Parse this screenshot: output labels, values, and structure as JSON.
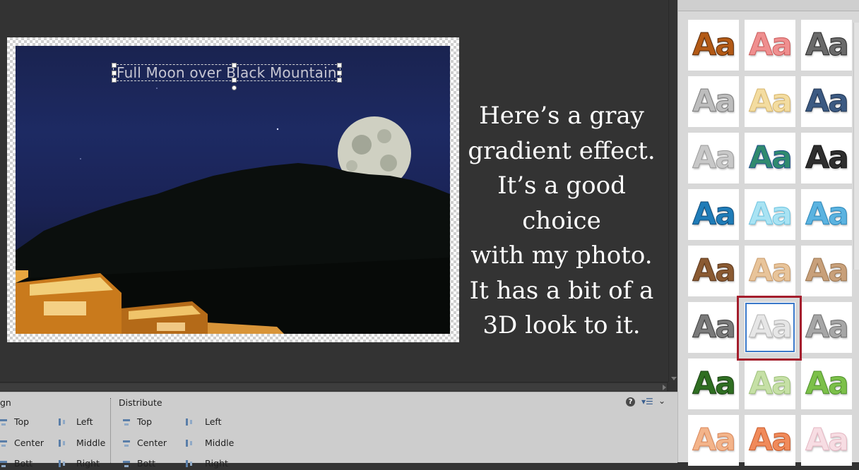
{
  "document": {
    "text_layer": "Full Moon over Black Mountain"
  },
  "caption": {
    "lines": [
      "Here’s a gray",
      "gradient effect.",
      "It’s a good choice",
      "with my photo.",
      "It has a bit of a",
      "3D look to it."
    ]
  },
  "align_panel": {
    "title": "gn",
    "items": [
      {
        "label": "Top"
      },
      {
        "label": "Left"
      },
      {
        "label": "Center"
      },
      {
        "label": "Middle"
      },
      {
        "label": "Bott"
      },
      {
        "label": "Right"
      }
    ]
  },
  "distribute_panel": {
    "title": "Distribute",
    "items": [
      {
        "label": "Top"
      },
      {
        "label": "Left"
      },
      {
        "label": "Center"
      },
      {
        "label": "Middle"
      },
      {
        "label": "Bott"
      },
      {
        "label": "Right"
      }
    ]
  },
  "panel_icons": {
    "help": "?",
    "menu": "▾☰",
    "collapse": "⌄"
  },
  "styles": {
    "sample_text": "Aa",
    "selected_index": 16,
    "swatches": [
      {
        "name": "leopard",
        "fill": "#b35a16",
        "stroke": "#5a2a08"
      },
      {
        "name": "pink",
        "fill": "#ef8f8f",
        "stroke": "#c95a5a"
      },
      {
        "name": "dark-chrome",
        "fill": "#6a6a6a",
        "stroke": "#2a2a2a"
      },
      {
        "name": "silver-bevel",
        "fill": "#bdbdbd",
        "stroke": "#7a7a7a"
      },
      {
        "name": "cream",
        "fill": "#f3dca0",
        "stroke": "#d6b46a"
      },
      {
        "name": "denim",
        "fill": "#3c5a82",
        "stroke": "#1f3452"
      },
      {
        "name": "light-gray",
        "fill": "#c8c8c8",
        "stroke": "#9a9a9a"
      },
      {
        "name": "green-blue",
        "fill": "#2f8a6e",
        "stroke": "#1f4f8a"
      },
      {
        "name": "black-chrome",
        "fill": "#2e2e2e",
        "stroke": "#111111"
      },
      {
        "name": "blue-steel",
        "fill": "#1f7cb8",
        "stroke": "#0f4c7a"
      },
      {
        "name": "ice-blue",
        "fill": "#a9e3f3",
        "stroke": "#6cc3e0"
      },
      {
        "name": "sky-blue",
        "fill": "#5bb3e0",
        "stroke": "#2b86b8"
      },
      {
        "name": "bronze",
        "fill": "#8a5a32",
        "stroke": "#5a3418"
      },
      {
        "name": "tan",
        "fill": "#e8c49a",
        "stroke": "#c89a6a"
      },
      {
        "name": "sand",
        "fill": "#c8a07a",
        "stroke": "#9a744e"
      },
      {
        "name": "gray-gradient-dark",
        "fill": "#7a7a7a",
        "stroke": "#3e3e3e"
      },
      {
        "name": "gray-gradient-light",
        "fill": "#e6e6e6",
        "stroke": "#b4b4b4"
      },
      {
        "name": "gray-gradient-mid",
        "fill": "#a6a6a6",
        "stroke": "#6e6e6e"
      },
      {
        "name": "dark-green",
        "fill": "#2f6e22",
        "stroke": "#1a4212"
      },
      {
        "name": "pale-green",
        "fill": "#c6e0a6",
        "stroke": "#9cc078"
      },
      {
        "name": "lime-green",
        "fill": "#7cc04a",
        "stroke": "#4e902a"
      },
      {
        "name": "peach",
        "fill": "#f3b48a",
        "stroke": "#d8865a"
      },
      {
        "name": "orange",
        "fill": "#f08a5a",
        "stroke": "#c85a2a"
      },
      {
        "name": "blush",
        "fill": "#f7dde3",
        "stroke": "#e4b6c2"
      }
    ]
  },
  "colors": {
    "accent_selection": "#a41d2c",
    "swatch_selected_outline": "#3a78c9",
    "workspace": "#333333"
  }
}
